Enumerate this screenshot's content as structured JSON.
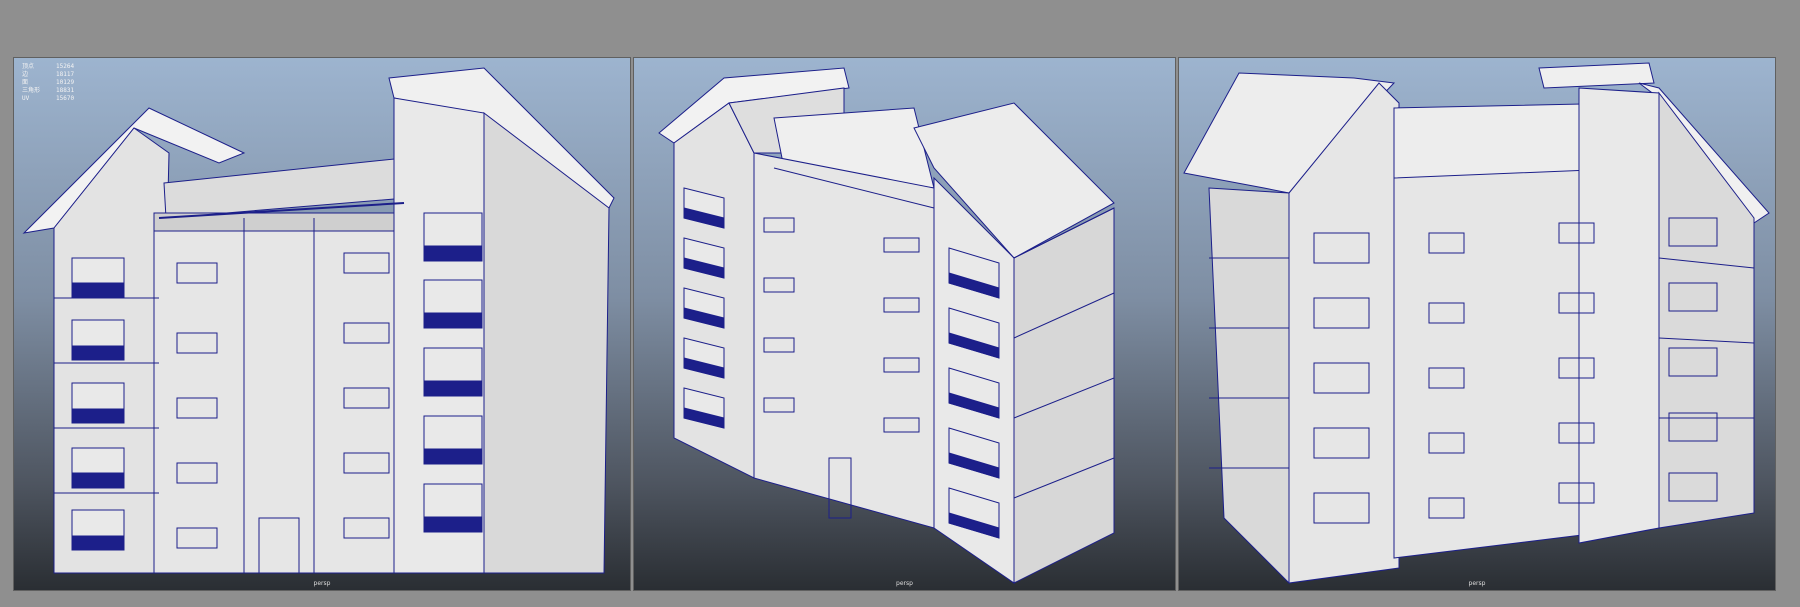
{
  "hud": {
    "rows": [
      {
        "label": "顶点",
        "value": "15264"
      },
      {
        "label": "边",
        "value": "18117"
      },
      {
        "label": "面",
        "value": "10129"
      },
      {
        "label": "三角形",
        "value": "18831"
      },
      {
        "label": "UV",
        "value": "15670"
      }
    ]
  },
  "viewports": [
    {
      "camera": "persp"
    },
    {
      "camera": "persp"
    },
    {
      "camera": "persp"
    }
  ],
  "colors": {
    "background": "#8f8f8f",
    "wireframe": "#1c1f8a",
    "surface": "#e6e6e6"
  }
}
